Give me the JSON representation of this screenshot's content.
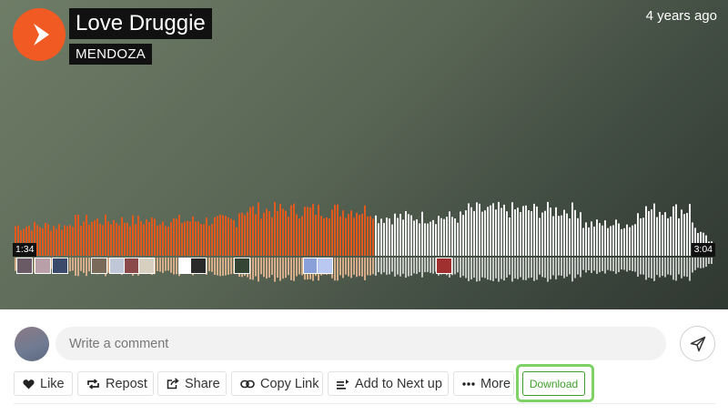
{
  "track": {
    "title": "Love Druggie",
    "artist": "MENDOZA",
    "posted": "4 years ago"
  },
  "player": {
    "current_time": "1:34",
    "total_time": "3:04",
    "progress": 0.514,
    "played_color": "#e05a1e",
    "unplayed_color": "#f4f4f4",
    "played_reflection_color": "#e3b690",
    "unplayed_reflection_color": "#eeeeee",
    "brand_color": "#f15a22"
  },
  "comment": {
    "placeholder": "Write a comment"
  },
  "actions": {
    "like": "Like",
    "repost": "Repost",
    "share": "Share",
    "copy_link": "Copy Link",
    "add_to_next_up": "Add to Next up",
    "more": "More",
    "download": "Download",
    "download_color": "#3f9f2a"
  }
}
